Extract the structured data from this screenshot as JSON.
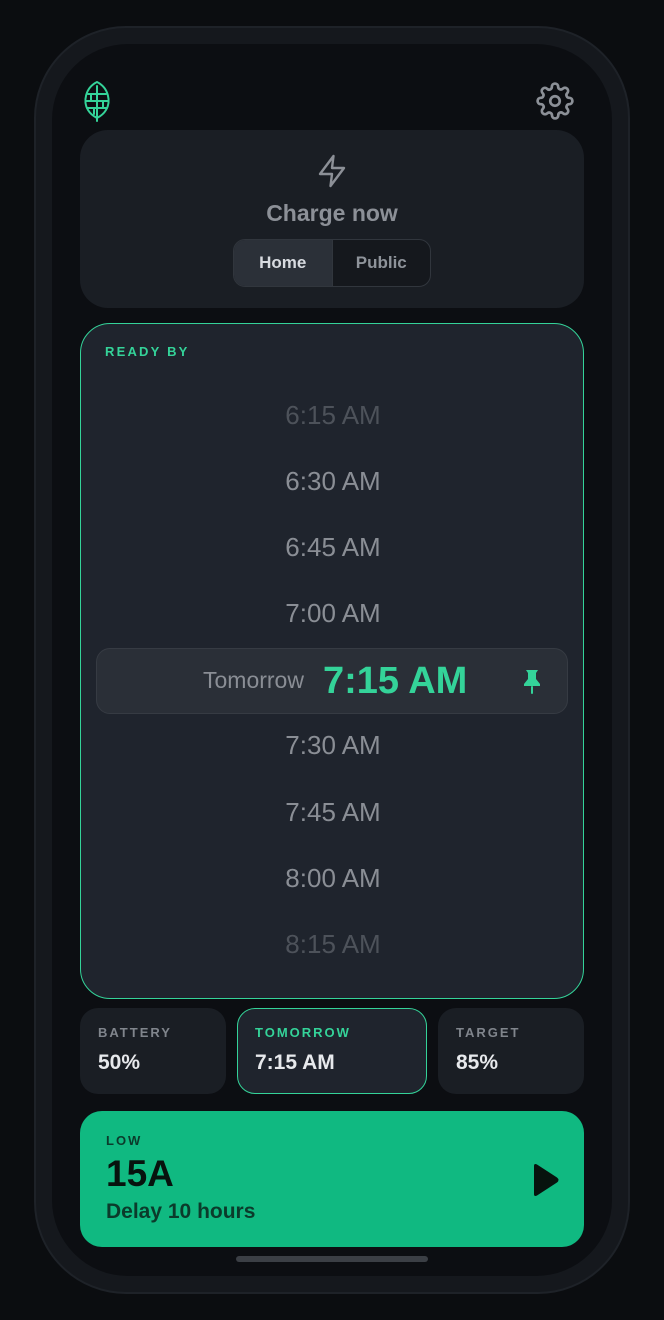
{
  "header": {
    "logo_icon": "leaf-icon",
    "settings_icon": "gear-icon"
  },
  "charge_now": {
    "icon": "lightning-bolt-icon",
    "title": "Charge now",
    "options": [
      {
        "label": "Home",
        "selected": true
      },
      {
        "label": "Public",
        "selected": false
      }
    ]
  },
  "ready_by": {
    "label": "READY BY",
    "times_before": [
      "6:15 AM",
      "6:30 AM",
      "6:45 AM",
      "7:00 AM"
    ],
    "selected": {
      "day": "Tomorrow",
      "time": "7:15 AM",
      "icon": "pin-icon"
    },
    "times_after": [
      "7:30 AM",
      "7:45 AM",
      "8:00 AM",
      "8:15 AM"
    ]
  },
  "stats": [
    {
      "label": "BATTERY",
      "value": "50%"
    },
    {
      "label": "TOMORROW",
      "value": "7:15 AM"
    },
    {
      "label": "TARGET",
      "value": "85%"
    }
  ],
  "action": {
    "label": "LOW",
    "amperage": "15A",
    "subtitle": "Delay 10 hours",
    "icon": "play-icon"
  },
  "colors": {
    "accent": "#34d399",
    "action_bg": "#10b981",
    "background": "#0c0e12",
    "card": "#1a1e24"
  }
}
